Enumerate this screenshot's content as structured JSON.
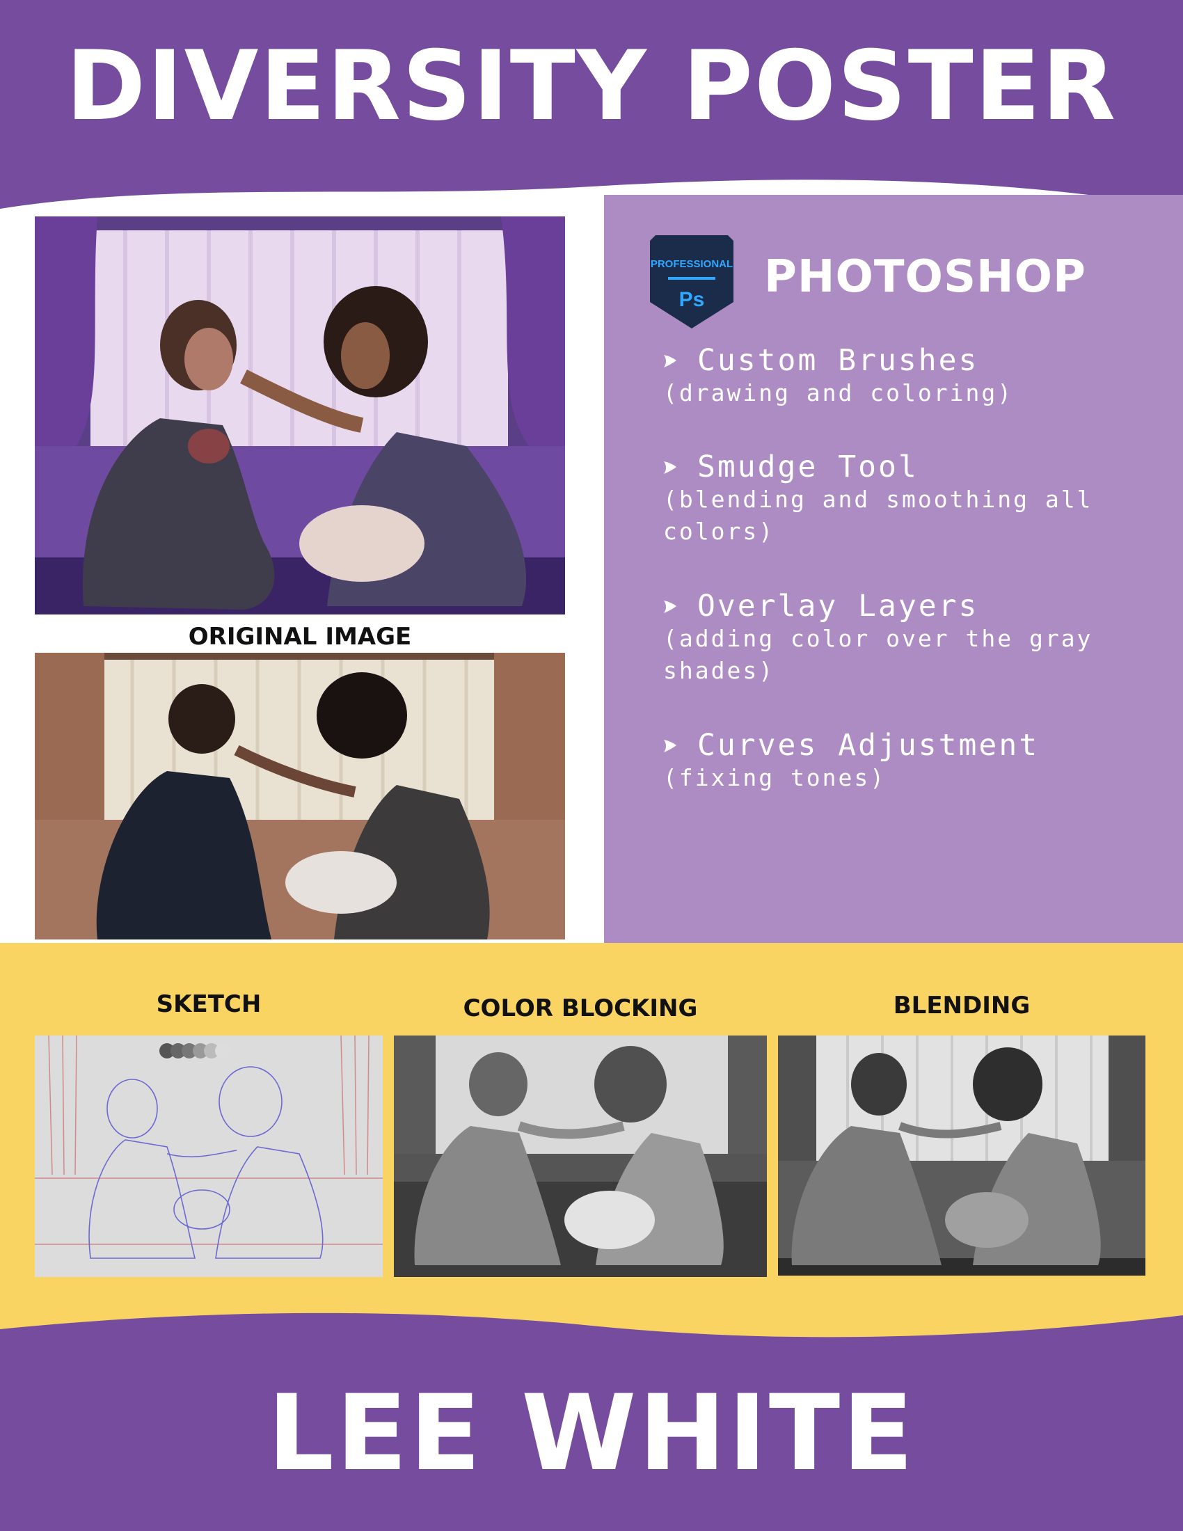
{
  "header": {
    "title": "DIVERSITY POSTER"
  },
  "images": {
    "final_label": "",
    "original_caption": "ORIGINAL IMAGE"
  },
  "tool": {
    "badge_top": "PROFESSIONAL",
    "badge_bottom": "Ps",
    "name": "PHOTOSHOP"
  },
  "techniques": [
    {
      "title": "Custom Brushes",
      "detail": "(drawing and coloring)"
    },
    {
      "title": "Smudge Tool",
      "detail": "(blending and smoothing all colors)"
    },
    {
      "title": "Overlay Layers",
      "detail": "(adding color over the gray shades)"
    },
    {
      "title": "Curves Adjustment",
      "detail": "(fixing tones)"
    }
  ],
  "process": [
    {
      "caption": "SKETCH"
    },
    {
      "caption": "COLOR BLOCKING"
    },
    {
      "caption": "BLENDING"
    }
  ],
  "footer": {
    "name": "LEE WHITE"
  },
  "colors": {
    "purple": "#754c9e",
    "lavender": "#ad8cc4",
    "yellow": "#fad462",
    "white": "#ffffff"
  }
}
